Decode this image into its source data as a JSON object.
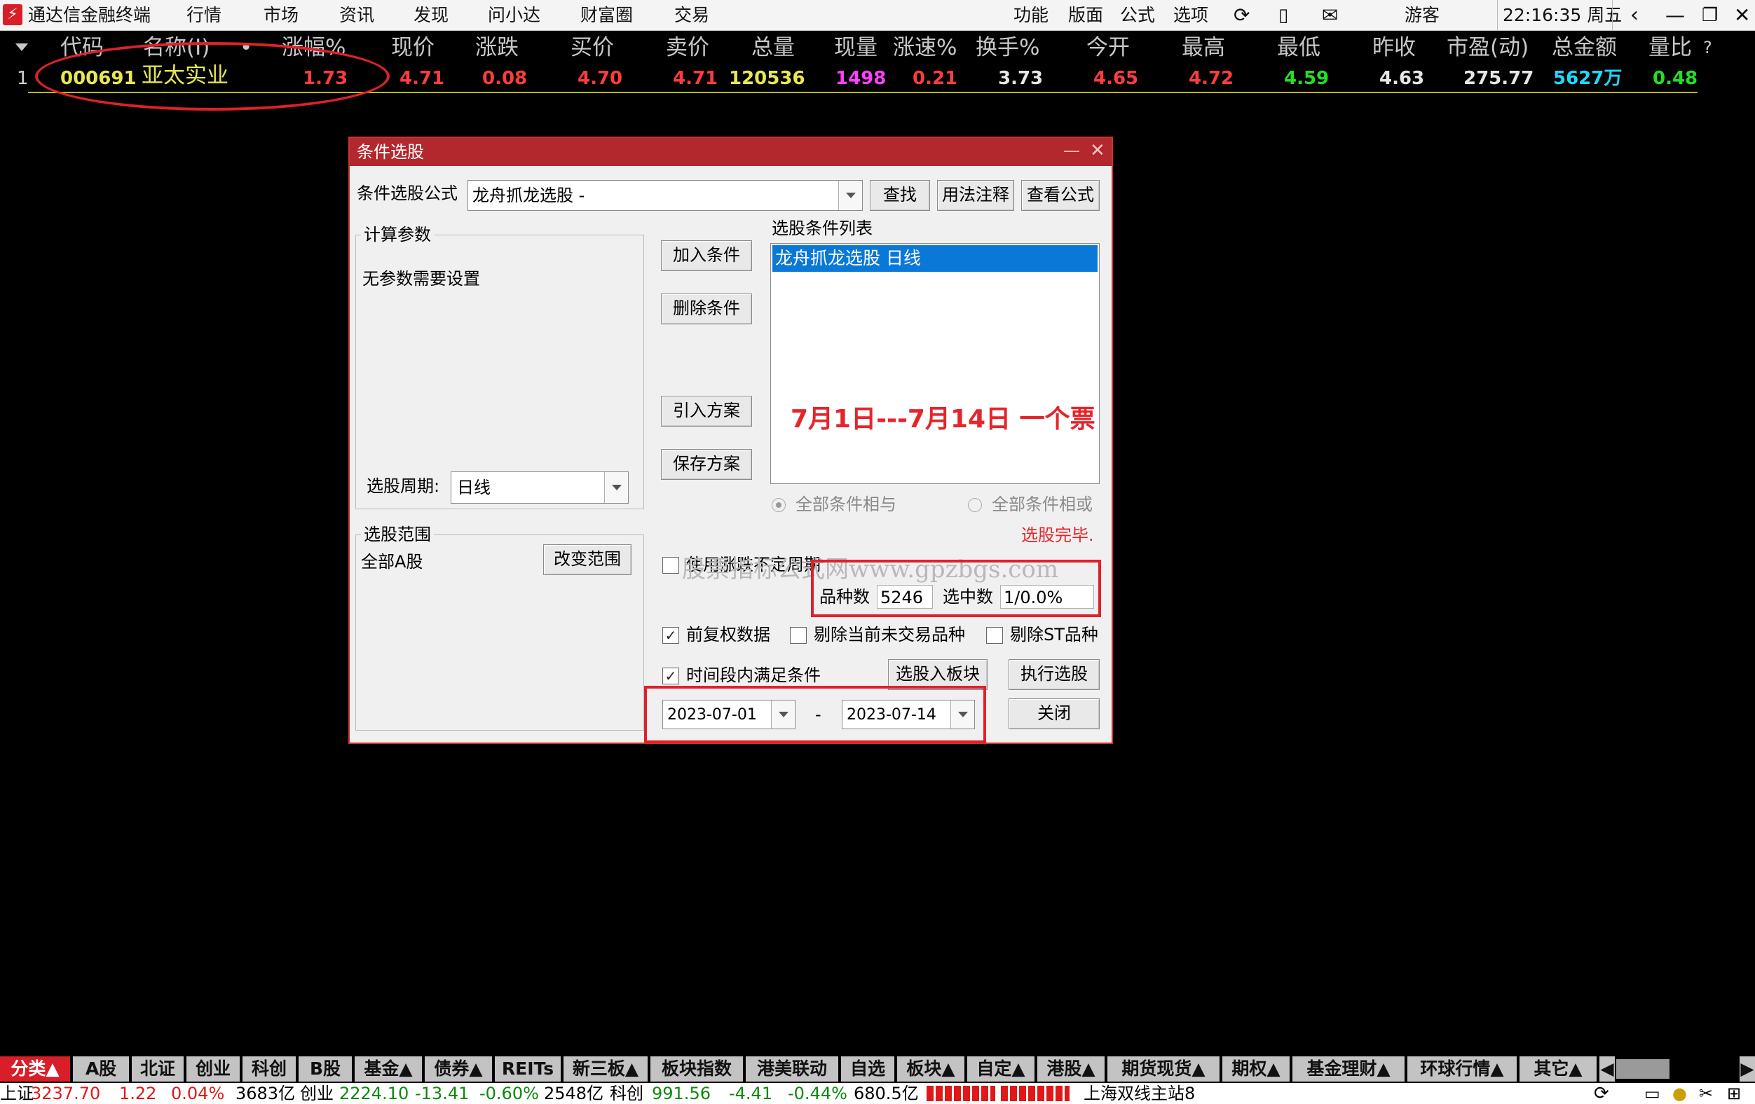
{
  "app": {
    "title": "通达信金融终端",
    "time": "22:16:35 周五",
    "user": "游客"
  },
  "menu": [
    "行情",
    "市场",
    "资讯",
    "发现",
    "问小达",
    "财富圈",
    "交易"
  ],
  "right_menu": [
    "功能",
    "版面",
    "公式",
    "选项"
  ],
  "columns": [
    "代码",
    "名称(I)",
    "•",
    "涨幅%",
    "现价",
    "涨跌",
    "买价",
    "卖价",
    "总量",
    "现量",
    "涨速%",
    "换手%",
    "今开",
    "最高",
    "最低",
    "昨收",
    "市盈(动)",
    "总金额",
    "量比"
  ],
  "column_help": "?",
  "row": {
    "index": "1",
    "code": "000691",
    "name": "亚太实业",
    "change_pct": "1.73",
    "price": "4.71",
    "change": "0.08",
    "bid": "4.70",
    "ask": "4.71",
    "volume": "120536",
    "cur_vol": "1498",
    "speed": "0.21",
    "turnover": "3.73",
    "open": "4.65",
    "high": "4.72",
    "low": "4.59",
    "prev_close": "4.63",
    "pe": "275.77",
    "amount": "5627万",
    "vol_ratio": "0.48"
  },
  "dialog": {
    "title": "条件选股",
    "formula_label": "条件选股公式",
    "formula_value": "龙舟抓龙选股  -",
    "btn_find": "查找",
    "btn_usage": "用法注释",
    "btn_view": "查看公式",
    "params_group": "计算参数",
    "params_text": "无参数需要设置",
    "period_label": "选股周期:",
    "period_value": "日线",
    "scope_group": "选股范围",
    "scope_text": "全部A股",
    "btn_change_scope": "改变范围",
    "btn_add": "加入条件",
    "btn_delete": "删除条件",
    "btn_import": "引入方案",
    "btn_save": "保存方案",
    "list_label": "选股条件列表",
    "list_items": [
      "龙舟抓龙选股  日线"
    ],
    "annotation": "7月1日---7月14日 一个票",
    "radio_and": "全部条件相与",
    "radio_or": "全部条件相或",
    "done_text": "选股完毕.",
    "use_range_label": "使用涨跌不定周期",
    "watermark": "股票指标公式网www.gpzbgs.com",
    "count_label": "品种数",
    "count_value": "5246",
    "selected_label": "选中数",
    "selected_value": "1/0.0%",
    "cb_fq": "前复权数据",
    "cb_untraded": "剔除当前未交易品种",
    "cb_st": "剔除ST品种",
    "cb_time": "时间段内满足条件",
    "btn_to_block": "选股入板块",
    "btn_execute": "执行选股",
    "btn_close": "关闭",
    "date_from": "2023-07-01",
    "date_sep": "-",
    "date_to": "2023-07-14"
  },
  "tabs": [
    "分类▲",
    "A股",
    "北证",
    "创业",
    "科创",
    "B股",
    "基金▲",
    "债券▲",
    "REITs",
    "新三板▲",
    "板块指数",
    "港美联动",
    "自选",
    "板块▲",
    "自定▲",
    "港股▲",
    "期货现货▲",
    "期权▲",
    "基金理财▲",
    "环球行情▲",
    "其它▲"
  ],
  "status": {
    "sh_label": "上证",
    "sh_value": "3237.70",
    "sh_change": "1.22",
    "sh_pct": "0.04%",
    "sh_amount": "3683亿",
    "cy_label": "创业",
    "cy_value": "2224.10",
    "cy_change": "-13.41",
    "cy_pct": "-0.60%",
    "cy_amount": "2548亿",
    "kc_label": "科创",
    "kc_value": "991.56",
    "kc_change": "-4.41",
    "kc_pct": "-0.44%",
    "kc_amount": "680.5亿",
    "server": "上海双线主站8"
  },
  "colors": {
    "up": "#ff3c3c",
    "down": "#22e022",
    "yellow": "#e8e850",
    "magenta": "#ff40ff",
    "cyan": "#20d8ff",
    "title_red": "#b3282d"
  }
}
